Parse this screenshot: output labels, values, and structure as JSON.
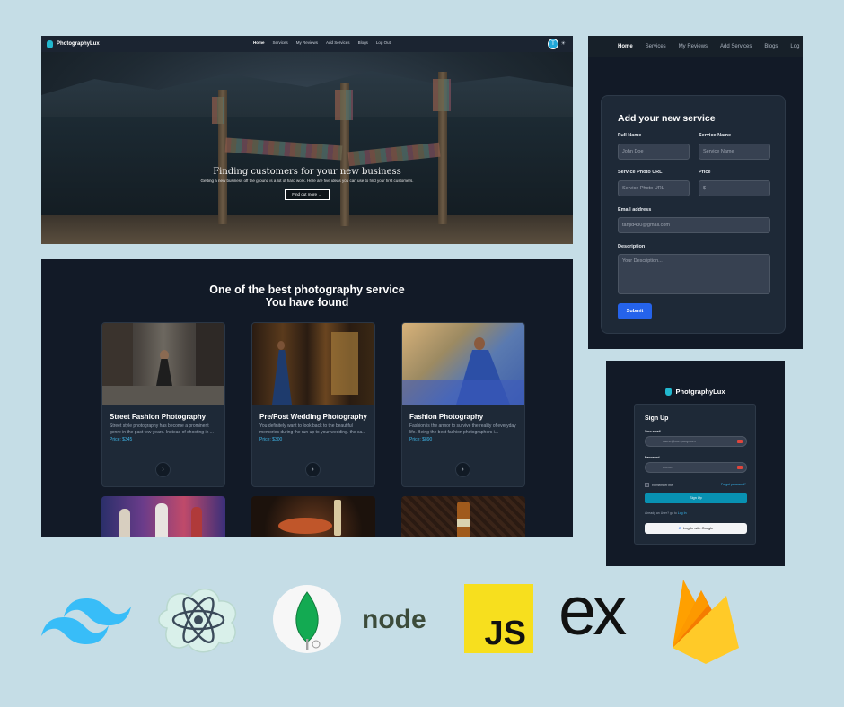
{
  "hero": {
    "brand": "PhotographyLux",
    "nav": [
      "Home",
      "Services",
      "My Reviews",
      "Add Services",
      "Blogs",
      "Log Out"
    ],
    "avatar_letter": "T",
    "title": "Finding customers for your new business",
    "subtitle": "Getting a new business off the ground is a lot of hard work. Here are five ideas you can use to find your first customers.",
    "button": "Find out more →"
  },
  "services": {
    "heading_line1": "One of the best photography service",
    "heading_line2": "You have found",
    "cards": [
      {
        "title": "Street Fashion Photography",
        "desc": "Street style photography has become a prominent genre in the past few years. Instead of shooting in ...",
        "price": "Price: $345"
      },
      {
        "title": "Pre/Post Wedding Photography",
        "desc": "You definitely want to look back to the beautiful memories during the run up to your wedding. the sa...",
        "price": "Price: $300"
      },
      {
        "title": "Fashion Photography",
        "desc": "Fashion is the armor to survive the reality of everyday life. Being the best fashion photographers i...",
        "price": "Price: $890"
      }
    ]
  },
  "add_service": {
    "nav": [
      "Home",
      "Services",
      "My Reviews",
      "Add Services",
      "Blogs",
      "Log"
    ],
    "title": "Add your new service",
    "full_name_label": "Full Name",
    "full_name_placeholder": "John Doe",
    "service_name_label": "Service Name",
    "service_name_placeholder": "Service Name",
    "photo_url_label": "Service Photo URL",
    "photo_url_placeholder": "Service Photo URL",
    "price_label": "Price",
    "price_placeholder": "$",
    "email_label": "Email address",
    "email_value": "tanjid430@gmail.com",
    "description_label": "Description",
    "description_placeholder": "Your Description...",
    "submit": "Submit"
  },
  "signup": {
    "brand": "PhotgraphyLux",
    "title": "Sign Up",
    "email_label": "Your email",
    "email_placeholder": "name@company.com",
    "password_label": "Password",
    "password_placeholder": "••••••••",
    "remember": "Remember me",
    "forgot": "Forgot password?",
    "button": "Sign Up",
    "login_prompt": "Already an User? go to ",
    "login_link": "Log In",
    "google": "Log In with Google"
  },
  "tech_logos": {
    "icons": [
      "tailwind-icon",
      "react-icon",
      "mongodb-icon",
      "node-icon",
      "javascript-icon",
      "express-icon",
      "firebase-icon"
    ],
    "node_text": "node",
    "js_text": "JS",
    "express_text": "ex"
  }
}
